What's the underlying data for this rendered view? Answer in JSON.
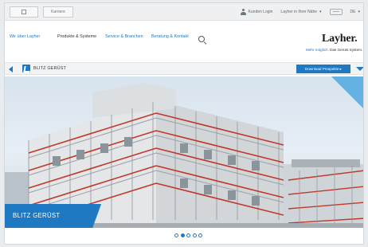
{
  "utility_bar": {
    "tabs": [
      {
        "icon": "grid-icon"
      },
      {
        "label": "Karriere"
      }
    ],
    "login_label": "Kunden Login",
    "country_label": "Layher in Ihrer Nähe",
    "language_label": "DE"
  },
  "main_nav": {
    "items": [
      {
        "label": "Wir über Layher"
      },
      {
        "label": "Produkte & Systeme"
      },
      {
        "label": "Service & Branchen"
      },
      {
        "label": "Beratung & Kontakt"
      }
    ],
    "active_index": 1
  },
  "brand": {
    "logo_text": "Layher.",
    "tagline_blue": "Mehr möglich.",
    "tagline_dark": "Das Gerüst System.",
    "accent_color": "#1e78c2"
  },
  "breadcrumb": {
    "label": "BLITZ GERÜST",
    "download_label": "Download Prospekte ▸"
  },
  "hero": {
    "caption": "BLITZ GERÜST"
  },
  "pager": {
    "total": 5,
    "active_index": 1
  }
}
